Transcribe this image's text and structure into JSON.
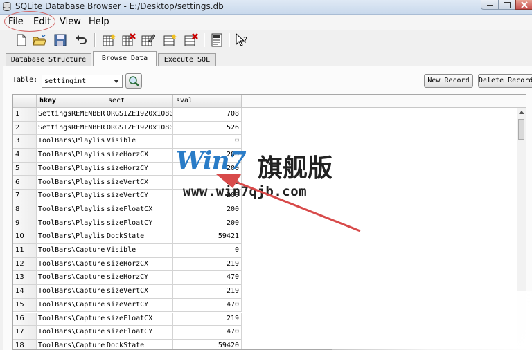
{
  "window": {
    "title": "SQLite Database Browser - E:/Desktop/settings.db"
  },
  "menu": {
    "items": [
      "File",
      "Edit",
      "View",
      "Help"
    ]
  },
  "toolbar": {
    "icons": [
      "new-database-icon",
      "open-database-icon",
      "save-icon",
      "undo-icon",
      "create-table-icon",
      "delete-table-icon",
      "modify-table-icon",
      "create-index-icon",
      "delete-index-icon",
      "log-icon",
      "whats-this-icon"
    ]
  },
  "tabs": [
    {
      "label": "Database Structure"
    },
    {
      "label": "Browse Data"
    },
    {
      "label": "Execute SQL"
    }
  ],
  "browse": {
    "table_label": "Table:",
    "table_value": "settingint",
    "new_record": "New Record",
    "delete_record": "Delete Record"
  },
  "grid": {
    "columns": [
      "hkey",
      "sect",
      "sval"
    ],
    "rows": [
      {
        "n": "1",
        "hkey": "SettingsREMENBER",
        "sect": "ORGSIZE1920x1080",
        "sval": "708"
      },
      {
        "n": "2",
        "hkey": "SettingsREMENBER",
        "sect": "ORGSIZE1920x1080",
        "sval": "526"
      },
      {
        "n": "3",
        "hkey": "ToolBars\\Playlis",
        "sect": "Visible",
        "sval": "0"
      },
      {
        "n": "4",
        "hkey": "ToolBars\\Playlis",
        "sect": "sizeHorzCX",
        "sval": "200"
      },
      {
        "n": "5",
        "hkey": "ToolBars\\Playlis",
        "sect": "sizeHorzCY",
        "sval": "200"
      },
      {
        "n": "6",
        "hkey": "ToolBars\\Playlis",
        "sect": "sizeVertCX",
        "sval": "200"
      },
      {
        "n": "7",
        "hkey": "ToolBars\\Playlis",
        "sect": "sizeVertCY",
        "sval": "200"
      },
      {
        "n": "8",
        "hkey": "ToolBars\\Playlis",
        "sect": "sizeFloatCX",
        "sval": "200"
      },
      {
        "n": "9",
        "hkey": "ToolBars\\Playlis",
        "sect": "sizeFloatCY",
        "sval": "200"
      },
      {
        "n": "10",
        "hkey": "ToolBars\\Playlis",
        "sect": "DockState",
        "sval": "59421"
      },
      {
        "n": "11",
        "hkey": "ToolBars\\Capture",
        "sect": "Visible",
        "sval": "0"
      },
      {
        "n": "12",
        "hkey": "ToolBars\\Capture",
        "sect": "sizeHorzCX",
        "sval": "219"
      },
      {
        "n": "13",
        "hkey": "ToolBars\\Capture",
        "sect": "sizeHorzCY",
        "sval": "470"
      },
      {
        "n": "14",
        "hkey": "ToolBars\\Capture",
        "sect": "sizeVertCX",
        "sval": "219"
      },
      {
        "n": "15",
        "hkey": "ToolBars\\Capture",
        "sect": "sizeVertCY",
        "sval": "470"
      },
      {
        "n": "16",
        "hkey": "ToolBars\\Capture",
        "sect": "sizeFloatCX",
        "sval": "219"
      },
      {
        "n": "17",
        "hkey": "ToolBars\\Capture",
        "sect": "sizeFloatCY",
        "sval": "470"
      },
      {
        "n": "18",
        "hkey": "ToolBars\\Capture",
        "sect": "DockState",
        "sval": "59420"
      }
    ]
  },
  "watermark": {
    "logo": "Win7",
    "cn": "旗舰版",
    "url": "www.win7qjb.com"
  },
  "colors": {
    "annotation_red": "#d06565",
    "watermark_blue": "#2a7cc7"
  }
}
